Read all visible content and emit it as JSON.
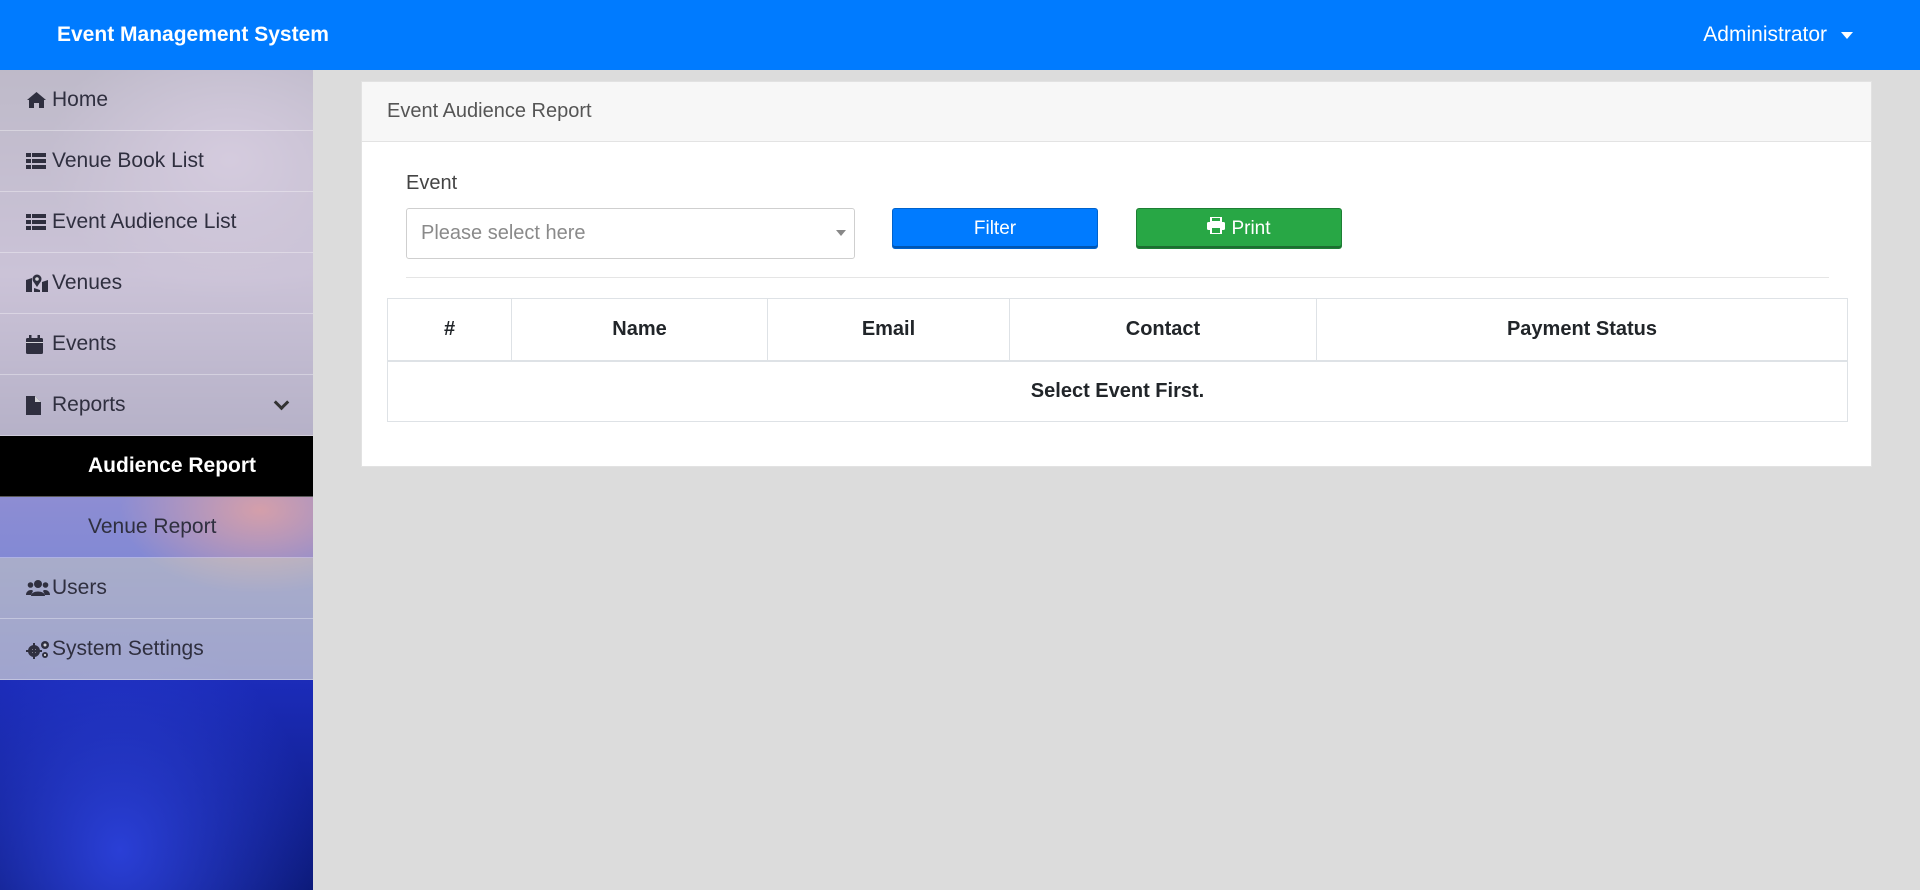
{
  "header": {
    "brand": "Event Management System",
    "user": "Administrator"
  },
  "sidebar": {
    "items": [
      {
        "label": "Home",
        "icon": "home-icon"
      },
      {
        "label": "Venue Book List",
        "icon": "list-icon"
      },
      {
        "label": "Event Audience List",
        "icon": "list-icon"
      },
      {
        "label": "Venues",
        "icon": "map-marker-icon"
      },
      {
        "label": "Events",
        "icon": "calendar-icon"
      },
      {
        "label": "Reports",
        "icon": "file-icon"
      },
      {
        "label": "Audience Report",
        "active": true
      },
      {
        "label": "Venue Report"
      },
      {
        "label": "Users",
        "icon": "users-icon"
      },
      {
        "label": "System Settings",
        "icon": "gears-icon"
      }
    ]
  },
  "report": {
    "title": "Event Audience Report",
    "event_label": "Event",
    "event_placeholder": "Please select here",
    "filter_label": "Filter",
    "print_label": "Print"
  },
  "table": {
    "columns": [
      "#",
      "Name",
      "Email",
      "Contact",
      "Payment Status"
    ],
    "empty_message": "Select Event First."
  },
  "colors": {
    "primary": "#007bff",
    "success": "#28a745",
    "active_nav": "#000000"
  }
}
